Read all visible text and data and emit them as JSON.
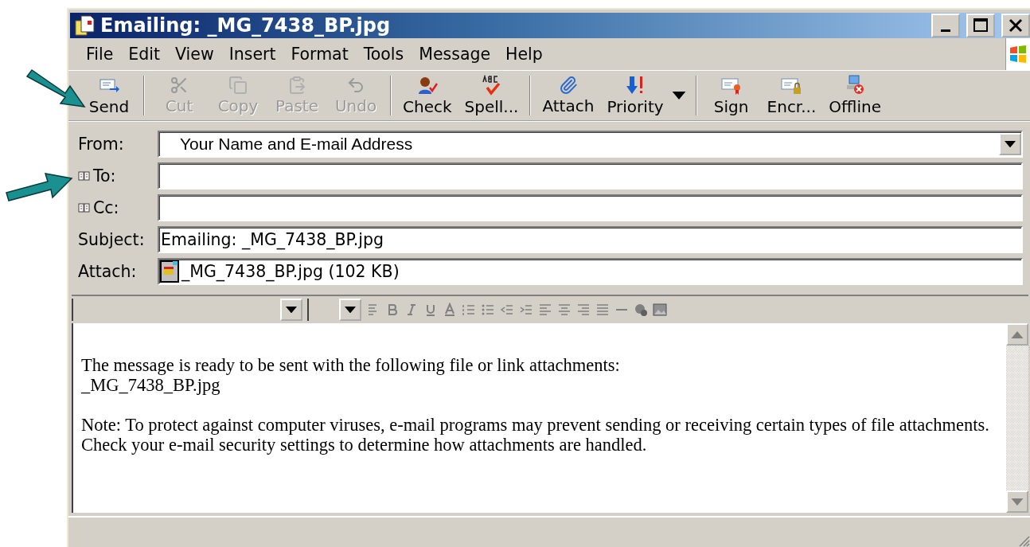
{
  "window": {
    "title": "Emailing: _MG_7438_BP.jpg"
  },
  "menu": [
    "File",
    "Edit",
    "View",
    "Insert",
    "Format",
    "Tools",
    "Message",
    "Help"
  ],
  "toolbar": [
    {
      "kind": "button",
      "label": "Send",
      "disabled": false
    },
    {
      "kind": "separator"
    },
    {
      "kind": "button",
      "label": "Cut",
      "disabled": true
    },
    {
      "kind": "button",
      "label": "Copy",
      "disabled": true
    },
    {
      "kind": "button",
      "label": "Paste",
      "disabled": true
    },
    {
      "kind": "button",
      "label": "Undo",
      "disabled": true
    },
    {
      "kind": "separator"
    },
    {
      "kind": "button",
      "label": "Check",
      "disabled": false
    },
    {
      "kind": "button",
      "label": "Spell...",
      "disabled": false
    },
    {
      "kind": "separator"
    },
    {
      "kind": "button",
      "label": "Attach",
      "disabled": false
    },
    {
      "kind": "dropdown",
      "label": "Priority",
      "disabled": false
    },
    {
      "kind": "separator"
    },
    {
      "kind": "button",
      "label": "Sign",
      "disabled": false
    },
    {
      "kind": "button",
      "label": "Encr...",
      "disabled": false
    },
    {
      "kind": "button",
      "label": "Offline",
      "disabled": false
    }
  ],
  "fields": [
    {
      "kind": "select",
      "label": "From:",
      "value": "Your Name and E-mail Address",
      "address_book": false
    },
    {
      "kind": "text",
      "label": "To:",
      "address_book": true
    },
    {
      "kind": "text",
      "label": "Cc:",
      "address_book": true
    },
    {
      "kind": "text",
      "label": "Subject:",
      "value": "Emailing: _MG_7438_BP.jpg",
      "address_book": false
    },
    {
      "kind": "attachment",
      "label": "Attach:",
      "value": "_MG_7438_BP.jpg (102 KB)",
      "address_book": false
    }
  ],
  "body": {
    "paragraphs": [
      [
        "The message is ready to be sent with the following file or link attachments:",
        "_MG_7438_BP.jpg"
      ],
      [
        "Note: To protect against computer viruses, e-mail programs may prevent sending or receiving certain types of file attachments.",
        "Check your e-mail security settings to determine how attachments are handled."
      ]
    ]
  }
}
